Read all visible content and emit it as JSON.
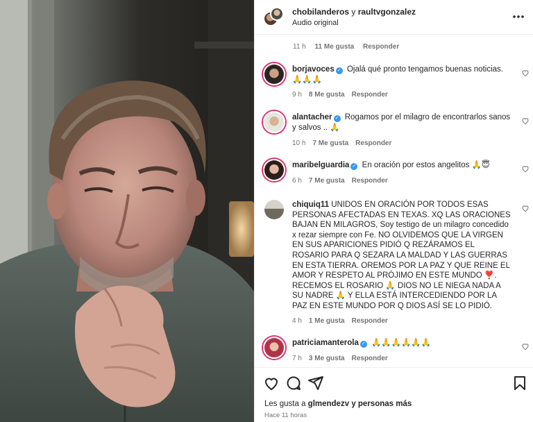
{
  "header": {
    "user1": "chobilanderos",
    "connector": "y",
    "user2": "raultvgonzalez",
    "audio": "Audio original"
  },
  "top_meta": {
    "time": "11 h",
    "likes": "11 Me gusta",
    "reply": "Responder"
  },
  "comments": [
    {
      "user": "borjavoces",
      "verified": true,
      "text": "Ojalá qué pronto tengamos buenas noticias. 🙏🙏🙏",
      "time": "9 h",
      "likes": "8 Me gusta",
      "reply": "Responder"
    },
    {
      "user": "alantacher",
      "verified": true,
      "text": "Rogamos por el milagro de encontrarlos sanos y salvos .. 🙏",
      "time": "10 h",
      "likes": "7 Me gusta",
      "reply": "Responder"
    },
    {
      "user": "maribelguardia",
      "verified": true,
      "text": "En oración por estos angelitos 🙏😇",
      "time": "6 h",
      "likes": "7 Me gusta",
      "reply": "Responder"
    },
    {
      "user": "chiquiq11",
      "verified": false,
      "text": "UNIDOS EN ORACIÓN POR TODOS ESAS PERSONAS AFECTADAS EN TEXAS. XQ LAS ORACIONES BAJAN EN MILAGROS, Soy testigo de un milagro concedido x rezar siempre con Fe. NO OLVIDEMOS QUE LA VIRGEN EN SUS APARICIONES PIDIÓ Q REZÁRAMOS EL ROSARIO PARA Q SEZARA LA MALDAD Y LAS GUERRAS EN ESTA TIERRA. OREMOS POR LA PAZ Y QUE REINE EL AMOR Y RESPETO AL PRÓJIMO EN ESTE MUNDO ❣️. RECEMOS EL ROSARIO 🙏 DIOS NO LE NIEGA NADA A SU NADRE 🙏 Y ELLA ESTÁ INTERCEDIENDO POR LA PAZ EN ESTE MUNDO POR Q DIOS ASÍ SE LO PIDIÓ.",
      "time": "4 h",
      "likes": "1 Me gusta",
      "reply": "Responder"
    },
    {
      "user": "patriciamanterola",
      "verified": true,
      "text": "🙏🙏🙏🙏🙏🙏",
      "time": "7 h",
      "likes": "3 Me gusta",
      "reply": "Responder"
    }
  ],
  "footer": {
    "likes_prefix": "Les gusta a",
    "likes_user": "glmendezv",
    "likes_suffix": "y personas más",
    "time_ago": "Hace 11 horas"
  },
  "icons": [
    "heart-icon",
    "comment-icon",
    "share-icon",
    "bookmark-icon",
    "more-options-icon",
    "verified-badge-icon"
  ],
  "colors": {
    "verified": "#3897f0",
    "story_ring": "#e1306c",
    "muted_text": "#737373"
  }
}
